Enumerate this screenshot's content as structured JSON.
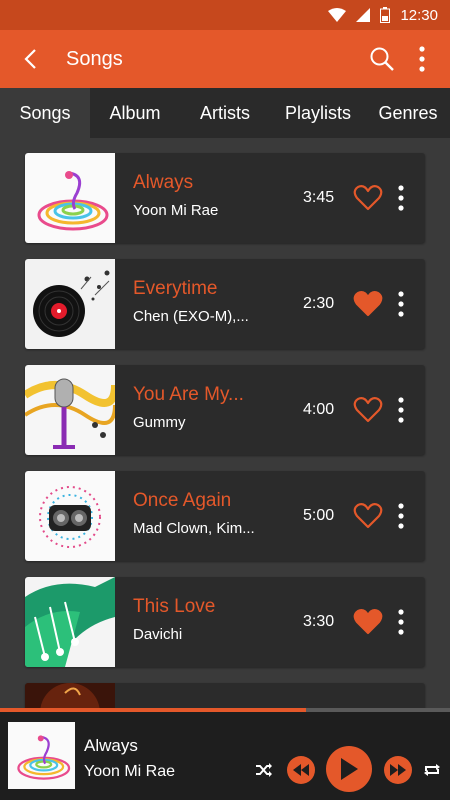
{
  "status": {
    "time": "12:30"
  },
  "appbar": {
    "title": "Songs"
  },
  "tabs": [
    {
      "label": "Songs",
      "active": true
    },
    {
      "label": "Album",
      "active": false
    },
    {
      "label": "Artists",
      "active": false
    },
    {
      "label": "Playlists",
      "active": false
    },
    {
      "label": "Genres",
      "active": false
    }
  ],
  "songs": [
    {
      "title": "Always",
      "artist": "Yoon Mi Rae",
      "duration": "3:45",
      "favorite": false
    },
    {
      "title": "Everytime",
      "artist": "Chen (EXO-M),...",
      "duration": "2:30",
      "favorite": true
    },
    {
      "title": "You Are My...",
      "artist": "Gummy",
      "duration": "4:00",
      "favorite": false
    },
    {
      "title": "Once Again",
      "artist": "Mad Clown, Kim...",
      "duration": "5:00",
      "favorite": false
    },
    {
      "title": "This Love",
      "artist": "Davichi",
      "duration": "3:30",
      "favorite": true
    }
  ],
  "now_playing": {
    "title": "Always",
    "artist": "Yoon Mi Rae",
    "progress": 0.68
  },
  "colors": {
    "accent": "#e4582a",
    "statusbar": "#c6481d",
    "card": "#2b2b2b",
    "background": "#3a3a3a"
  }
}
